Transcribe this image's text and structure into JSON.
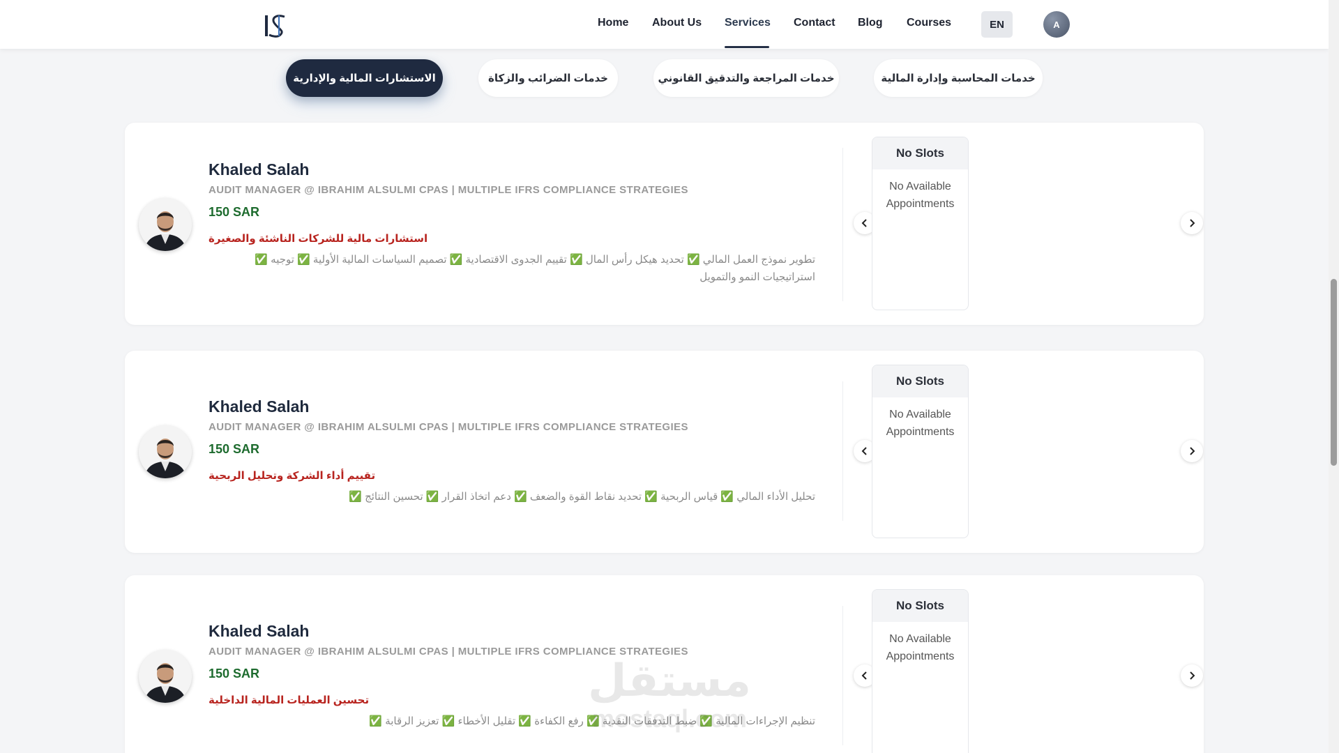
{
  "header": {
    "nav": [
      {
        "label": "Home"
      },
      {
        "label": "About Us"
      },
      {
        "label": "Services"
      },
      {
        "label": "Contact"
      },
      {
        "label": "Blog"
      },
      {
        "label": "Courses"
      }
    ],
    "active_nav": "Services",
    "language_button": "EN",
    "user_initial": "A",
    "logo_icon": "company-logo"
  },
  "tabs": [
    {
      "label": "الاستشارات المالية والإدارية",
      "active": true
    },
    {
      "label": "خدمات الضرائب والزكاة",
      "active": false
    },
    {
      "label": "خدمات المراجعة والتدقيق القانوني",
      "active": false
    },
    {
      "label": "خدمات المحاسبة وإدارة المالية",
      "active": false
    }
  ],
  "cards": [
    {
      "name": "Khaled Salah",
      "role": "AUDIT MANAGER @ IBRAHIM ALSULMI CPAS | MULTIPLE IFRS COMPLIANCE STRATEGIES",
      "price": "150 SAR",
      "service_title": "استشارات مالية للشركات الناشئة والصغيرة",
      "service_description": "تطوير نموذج العمل المالي ✅ تحديد هيكل رأس المال ✅ تقييم الجدوى الاقتصادية ✅ تصميم السياسات المالية الأولية ✅ توجيه ✅ استراتيجيات النمو والتمويل",
      "slots_header": "No Slots",
      "slots_message": "No Available Appointments"
    },
    {
      "name": "Khaled Salah",
      "role": "AUDIT MANAGER @ IBRAHIM ALSULMI CPAS | MULTIPLE IFRS COMPLIANCE STRATEGIES",
      "price": "150 SAR",
      "service_title": "تقييم أداء الشركة وتحليل الربحية",
      "service_description": "تحليل الأداء المالي ✅ قياس الربحية ✅ تحديد نقاط القوة والضعف ✅ دعم اتخاذ القرار ✅ تحسين النتائج ✅",
      "slots_header": "No Slots",
      "slots_message": "No Available Appointments"
    },
    {
      "name": "Khaled Salah",
      "role": "AUDIT MANAGER @ IBRAHIM ALSULMI CPAS | MULTIPLE IFRS COMPLIANCE STRATEGIES",
      "price": "150 SAR",
      "service_title": "تحسين العمليات المالية الداخلية",
      "service_description": "تنظيم الإجراءات المالية ✅ ضبط التدفقات النقدية ✅ رفع الكفاءة ✅ تقليل الأخطاء ✅ تعزيز الرقابة ✅",
      "slots_header": "No Slots",
      "slots_message": "No Available Appointments"
    }
  ],
  "watermark": {
    "arabic": "مستقل",
    "latin": "mostaql.com"
  },
  "colors": {
    "accent_dark": "#1f2a40",
    "price_green": "#1d6b2e",
    "service_red": "#b8241f"
  }
}
